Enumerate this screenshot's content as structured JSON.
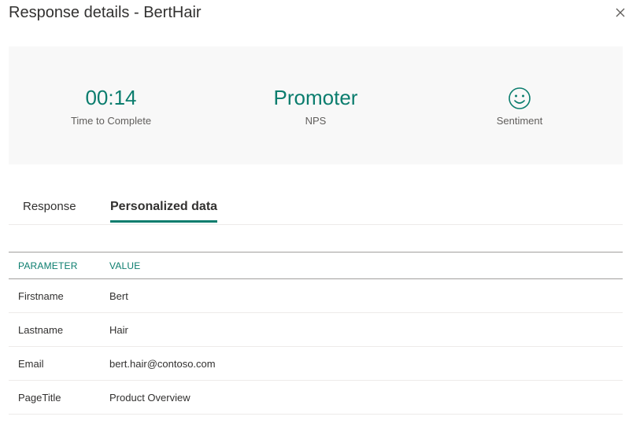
{
  "panel": {
    "title": "Response details - BertHair",
    "close_icon": "close-icon"
  },
  "summary": {
    "time": {
      "value": "00:14",
      "label": "Time to Complete"
    },
    "nps": {
      "value": "Promoter",
      "label": "NPS"
    },
    "sentiment": {
      "icon": "smiley-icon",
      "label": "Sentiment"
    }
  },
  "tabs": [
    {
      "label": "Response",
      "selected": false
    },
    {
      "label": "Personalized data",
      "selected": true
    }
  ],
  "table": {
    "columns": [
      "PARAMETER",
      "VALUE"
    ],
    "rows": [
      {
        "parameter": "Firstname",
        "value": "Bert"
      },
      {
        "parameter": "Lastname",
        "value": "Hair"
      },
      {
        "parameter": "Email",
        "value": "bert.hair@contoso.com"
      },
      {
        "parameter": "PageTitle",
        "value": "Product Overview"
      }
    ]
  },
  "colors": {
    "accent": "#0b7d6e",
    "summary_bg": "#f8f8f8"
  }
}
